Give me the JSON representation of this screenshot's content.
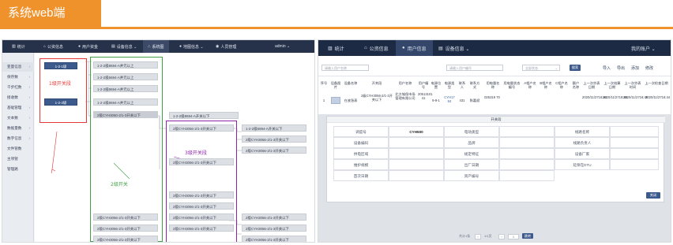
{
  "title": "系统web端",
  "left": {
    "nav": [
      {
        "icon": "bar-chart-icon",
        "label": "统计"
      },
      {
        "icon": "home-icon",
        "label": "公资信息"
      },
      {
        "icon": "user-group-icon",
        "label": "用户资金"
      },
      {
        "icon": "device-icon",
        "label": "设备信息 ⌄"
      },
      {
        "icon": "tree-icon",
        "label": "系统图"
      },
      {
        "icon": "location-icon",
        "label": "地图信息 ⌄"
      },
      {
        "icon": "person-icon",
        "label": "人员管理"
      }
    ],
    "user": "admin ⌄",
    "sidebar": [
      "变量信息",
      "保存数",
      "千步红数",
      "接收数",
      "基础管理",
      "文本数",
      "数据量数",
      "数字信息",
      "文件管数",
      "主项管",
      "管理路"
    ],
    "tree": {
      "col1": [
        "1-2-1级",
        "1-2-2级"
      ],
      "col2_top": [
        "1-2-2级8694-A并元以上",
        "1-2-2级6694-A并元以上",
        "1-2-2级8694-A并元以上",
        "1-2-2级8694-A并元以上"
      ],
      "col2_sel": "2级CYH3050-2/1-3开关以下",
      "col2_bottom": [
        "2级CYH3056-2/1-3开关以下",
        "2级CYH3056-2/1-3开关以下",
        "2级CYH3056-2/1-3开关以下",
        "2级CYH3056-2/1-3开关以下",
        "2级CYH3056-2/1-3开关以下",
        "2级CYH3056-2/1-3开关以下"
      ],
      "col3_top": [
        "1-2-2级8694-A开关以下",
        "2级CYH3056-2/1-3开关以下"
      ],
      "col3_mid": [
        "2级CYH3056-2/1-3开关以下"
      ],
      "col3_bottom": [
        "2级CYH3056-2/1-3开关以下",
        "2级CYH3056-2/1-3开关以下",
        "2级CYH3056-2/1-3开关以下",
        "2级CYH3056-2/1-3开关以下"
      ],
      "col4_top": [
        "1-2-2级6694-A开关以下",
        "2级CYH3056-2/1-3开关以下",
        "2级CYH3056-2/1-3开关以下"
      ],
      "col4_bottom": [
        "2级CYH3056-2/1-3开关以下",
        "2级CYH3056-2/1-3开关以下",
        "2级CYH3056-2/1-3开关以下",
        "2级CYH3056-2/1-3开关以下"
      ]
    },
    "annotations": {
      "level1": "1级开关段",
      "level2": "2级开关",
      "level3": "3级开关段"
    },
    "colors": {
      "level1": "#e53935",
      "level2": "#43a047",
      "level3": "#8e24aa",
      "accent": "#f0922b"
    }
  },
  "right": {
    "nav": [
      {
        "icon": "bar-chart-icon",
        "label": "统计"
      },
      {
        "icon": "home-icon",
        "label": "公资信息"
      },
      {
        "icon": "user-group-icon",
        "label": "用户信息"
      },
      {
        "icon": "device-icon",
        "label": "设备信息 ⌄"
      }
    ],
    "user": "我的账户 ⌄",
    "search1": "请输入用户名称",
    "search2": "请输入用户编号",
    "select": "全部状态",
    "search_btn": "搜索",
    "actions": [
      "导入",
      "导出",
      "添加",
      "修改"
    ],
    "headers": [
      "序号",
      "设备图片",
      "设备名称",
      "开关段",
      "用户名称",
      "用户编号",
      "电源位置",
      "电源类型",
      "联系人",
      "联系方式",
      "用电量名称",
      "用电量状态编号",
      "A相户名称",
      "B相户名称",
      "C相户名称",
      "额户名称",
      "上一次抄表日期",
      "上一次结算日期",
      "上一次抄表时间",
      "上一次检查日期"
    ],
    "row": [
      "1",
      "",
      "在液涨表",
      "2级CYH3056-2/1-3开关以下",
      "北方城保市场管理有限公司",
      "20513101 41",
      "9-9-1",
      "CYH17 84",
      "431",
      "陈嘉斌",
      "025319 70",
      "",
      "",
      "",
      "",
      "",
      "2020/11/2716:44",
      "2020/11/2716:45",
      "2020/11/2716:45",
      "2020/11/2716:44"
    ],
    "modal": {
      "title": "开关段",
      "rows": [
        [
          "调度号",
          "CYH500",
          "电动类型",
          "",
          "线路名称",
          ""
        ],
        [
          "设备编码",
          "",
          "品牌",
          "",
          "线路负责人",
          ""
        ],
        [
          "供电区域",
          "",
          "规定特征",
          "",
          "设备厂家",
          ""
        ],
        [
          "维护规模",
          "",
          "出厂日期",
          "",
          "延保在DTU",
          ""
        ],
        [
          "首次日期",
          "",
          "资产编号",
          "",
          "",
          ""
        ]
      ],
      "close": "关闭"
    },
    "pagination": {
      "total": "共计1条",
      "pages": "1/1页",
      "page": "1",
      "go": "跳转"
    }
  }
}
